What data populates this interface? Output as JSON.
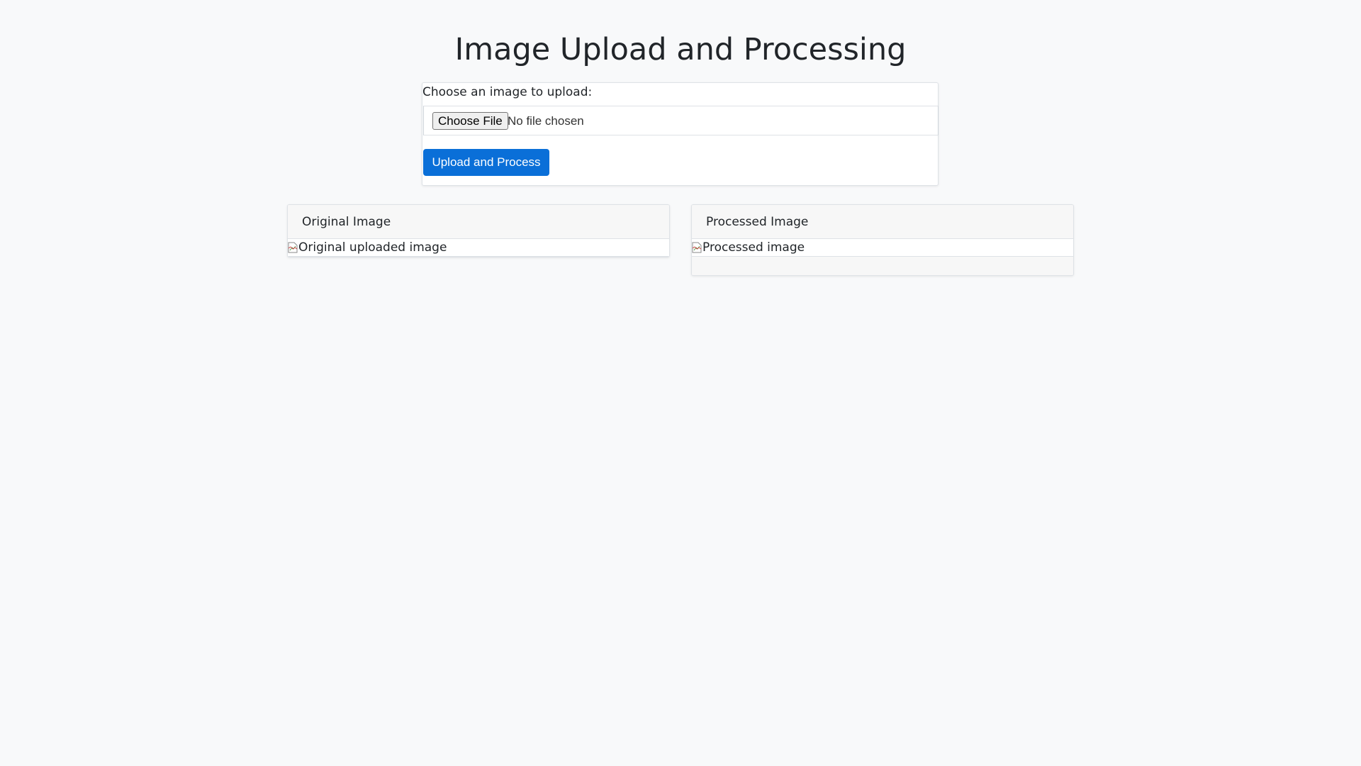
{
  "page": {
    "title": "Image Upload and Processing"
  },
  "upload_form": {
    "label": "Choose an image to upload:",
    "choose_file_label": "Choose File",
    "file_status": "No file chosen",
    "submit_label": "Upload and Process"
  },
  "original_card": {
    "header": "Original Image",
    "image_alt": "Original uploaded image"
  },
  "processed_card": {
    "header": "Processed Image",
    "image_alt": "Processed image"
  },
  "colors": {
    "background": "#f8f9fa",
    "primary_button": "#0a6fd8",
    "card_header": "#f7f7f7"
  }
}
